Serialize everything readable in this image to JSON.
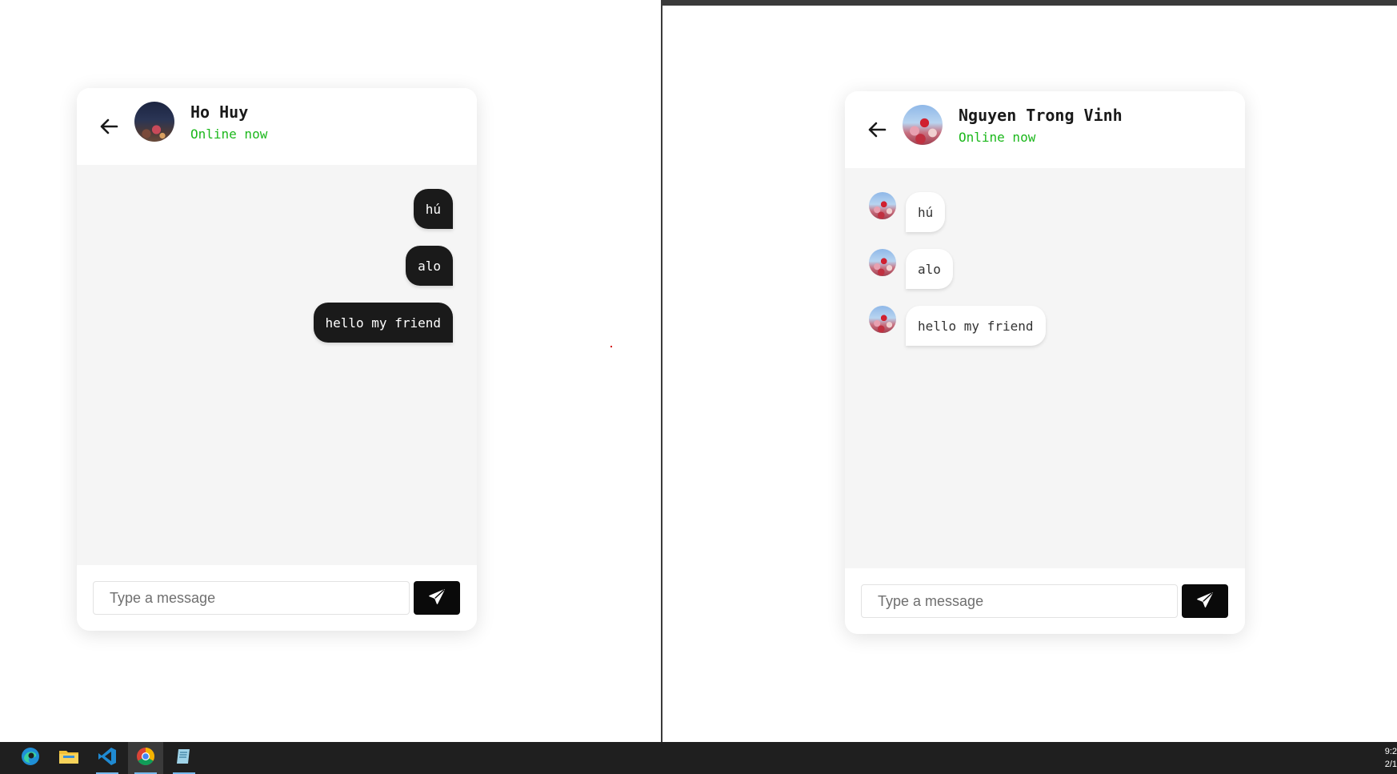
{
  "left_chat": {
    "contact_name": "Ho Huy",
    "status": "Online now",
    "messages": [
      {
        "text": "hú"
      },
      {
        "text": "alo"
      },
      {
        "text": "hello my friend"
      }
    ],
    "input_placeholder": "Type a message"
  },
  "right_chat": {
    "contact_name": "Nguyen Trong Vinh",
    "status": "Online now",
    "messages": [
      {
        "text": "hú"
      },
      {
        "text": "alo"
      },
      {
        "text": "hello my friend"
      }
    ],
    "input_placeholder": "Type a message"
  },
  "taskbar": {
    "apps": [
      "edge",
      "file-explorer",
      "vscode",
      "chrome",
      "notepad"
    ],
    "clock_time": "9:2",
    "clock_date": "2/1"
  },
  "colors": {
    "status_online": "#1cb81c",
    "outgoing_bubble": "#1a1a1a",
    "send_button": "#0a0a0a",
    "chat_background": "#f5f5f5"
  }
}
